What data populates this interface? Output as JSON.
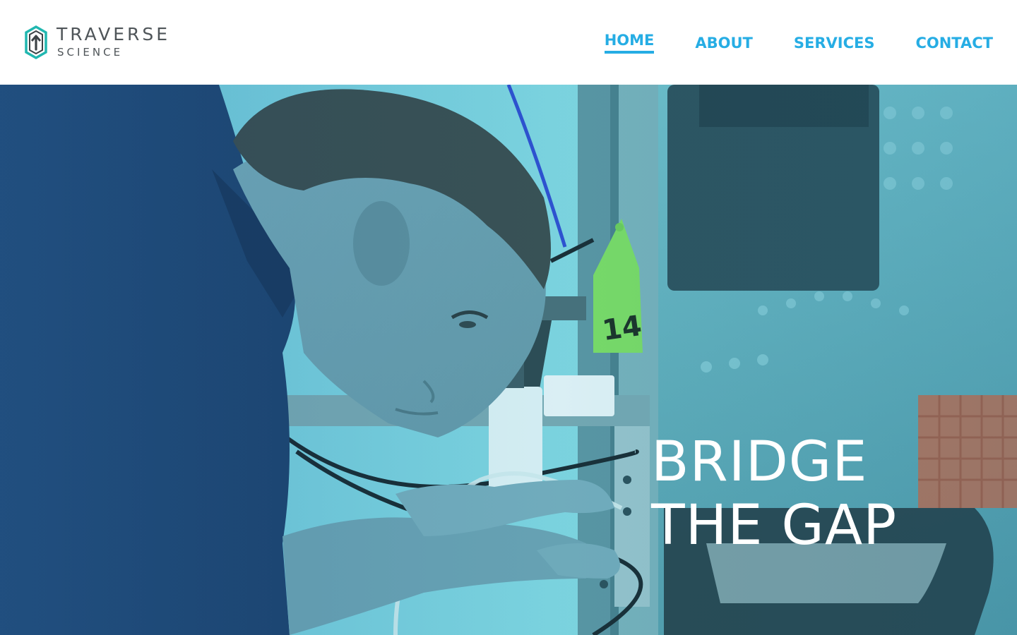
{
  "brand": {
    "name": "TRAVERSE",
    "subtitle": "SCIENCE",
    "logo_icon": "upward-arrow-hexagon-icon",
    "colors": {
      "teal": "#21b7b0",
      "dark": "#3d4347"
    }
  },
  "nav": {
    "items": [
      {
        "label": "HOME",
        "active": true
      },
      {
        "label": "ABOUT",
        "active": false
      },
      {
        "label": "SERVICES",
        "active": false
      },
      {
        "label": "CONTACT",
        "active": false
      }
    ],
    "color": "#26ade4"
  },
  "hero": {
    "headline_line1": "BRIDGE",
    "headline_line2": "THE GAP",
    "tag_number": "14"
  }
}
